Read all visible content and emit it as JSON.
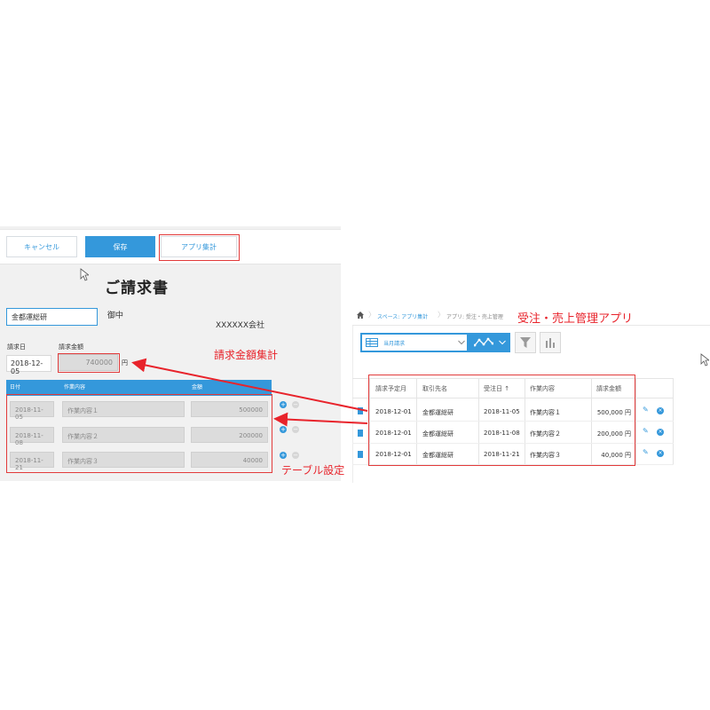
{
  "form": {
    "cancel_label": "キャンセル",
    "save_label": "保存",
    "app_total_label": "アプリ集計",
    "title": "ご請求書",
    "customer_value": "金都運総研",
    "honorific": "御中",
    "company": "XXXXXX会社",
    "invoice_date_label": "請求日",
    "invoice_amount_label": "請求金額",
    "invoice_date_value": "2018-12-05",
    "invoice_amount_value": "740000",
    "currency": "円",
    "table": {
      "headers": [
        "日付",
        "作業内容",
        "金額"
      ],
      "rows": [
        {
          "date": "2018-11-05",
          "task": "作業内容１",
          "amount": "500000"
        },
        {
          "date": "2018-11-08",
          "task": "作業内容２",
          "amount": "200000"
        },
        {
          "date": "2018-11-21",
          "task": "作業内容３",
          "amount": "40000"
        }
      ]
    }
  },
  "annotations": {
    "total": "請求金額集計",
    "table": "テーブル設定",
    "app": "受注・売上管理アプリ"
  },
  "list": {
    "breadcrumb_space": "スペース: アプリ集計",
    "breadcrumb_app": "アプリ: 受注・売上管理",
    "view_name": "当月請求",
    "headers": [
      "請求予定月",
      "取引先名",
      "受注日 ↑",
      "作業内容",
      "請求金額"
    ],
    "rows": [
      {
        "billing_month": "2018-12-01",
        "client": "金都運総研",
        "order_date": "2018-11-05",
        "task": "作業内容１",
        "amount": "500,000 円"
      },
      {
        "billing_month": "2018-12-01",
        "client": "金都運総研",
        "order_date": "2018-11-08",
        "task": "作業内容２",
        "amount": "200,000 円"
      },
      {
        "billing_month": "2018-12-01",
        "client": "金都運総研",
        "order_date": "2018-11-21",
        "task": "作業内容３",
        "amount": "40,000 円"
      }
    ]
  },
  "colors": {
    "accent": "#3498db",
    "highlight": "#e23b3b",
    "annotation": "#e8232b"
  }
}
